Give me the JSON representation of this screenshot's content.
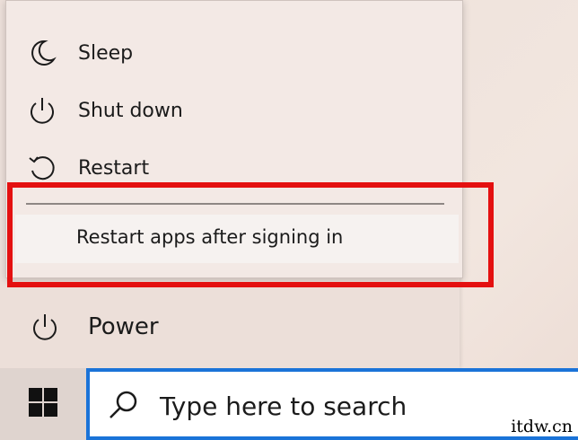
{
  "power_menu": {
    "items": [
      {
        "label": "Sleep",
        "icon": "moon-icon"
      },
      {
        "label": "Shut down",
        "icon": "power-icon"
      },
      {
        "label": "Restart",
        "icon": "restart-icon"
      }
    ],
    "restart_apps_option": "Restart apps after signing in"
  },
  "start_menu": {
    "power_label": "Power"
  },
  "taskbar": {
    "search_placeholder": "Type here to search"
  },
  "watermark": "itdw.cn",
  "colors": {
    "highlight": "#e41010",
    "search_border": "#1a73d8",
    "background": "#ecdfd9"
  }
}
